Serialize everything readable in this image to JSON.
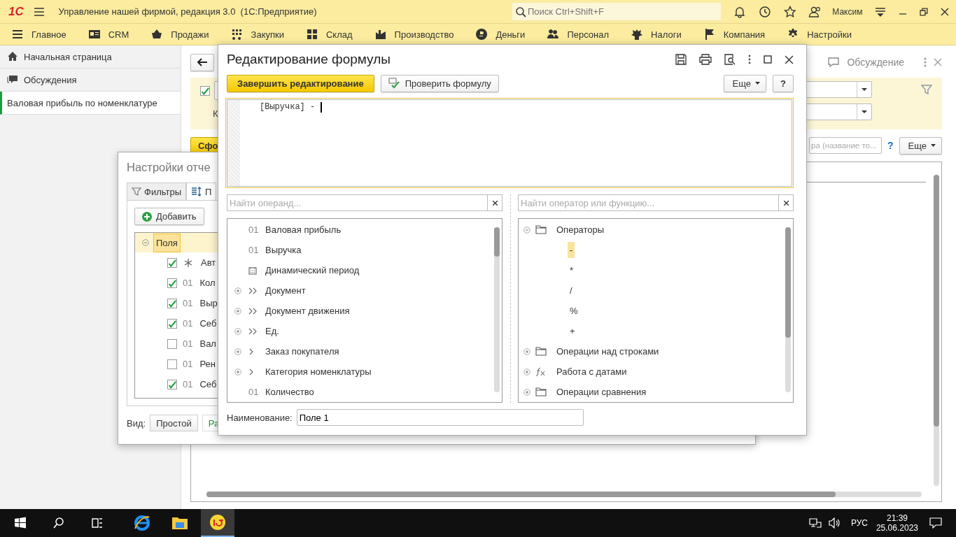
{
  "app_bar": {
    "logo": "1С",
    "title": "Управление нашей фирмой, редакция 3.0  (1С:Предприятие)",
    "search_placeholder": "Поиск Ctrl+Shift+F",
    "user": "Максим"
  },
  "sections": [
    {
      "label": "Главное"
    },
    {
      "label": "CRM"
    },
    {
      "label": "Продажи"
    },
    {
      "label": "Закупки"
    },
    {
      "label": "Склад"
    },
    {
      "label": "Производство"
    },
    {
      "label": "Деньги"
    },
    {
      "label": "Персонал"
    },
    {
      "label": "Налоги"
    },
    {
      "label": "Компания"
    },
    {
      "label": "Настройки"
    }
  ],
  "sidebar": {
    "items": [
      {
        "label": "Начальная страница",
        "selected": false
      },
      {
        "label": "Обсуждения",
        "selected": false
      },
      {
        "label": "Валовая прибыль по номенклатуре",
        "selected": true
      }
    ]
  },
  "report": {
    "discussion_link": "Обсуждение",
    "use_filter": {
      "checked": true
    },
    "label_fragment": "К",
    "generate_button": "Сфо",
    "search_placeholder": "ра (название то...",
    "help": "?",
    "more_button": "Еще"
  },
  "settings_dialog": {
    "title": "Настройки отче",
    "tabs": [
      {
        "label": "Фильтры",
        "selected": false
      },
      {
        "label": "П",
        "selected": true
      }
    ],
    "add_button": "Добавить",
    "tree": {
      "label": "Поля",
      "expanded": true,
      "children": [
        {
          "kind": "auto",
          "checked": true,
          "label": "Авт"
        },
        {
          "kind": "field",
          "checked": true,
          "prefix": "01",
          "label": "Кол"
        },
        {
          "kind": "field",
          "checked": true,
          "prefix": "01",
          "label": "Выр"
        },
        {
          "kind": "field",
          "checked": true,
          "prefix": "01",
          "label": "Себ"
        },
        {
          "kind": "field",
          "checked": false,
          "prefix": "01",
          "label": "Вал"
        },
        {
          "kind": "field",
          "checked": false,
          "prefix": "01",
          "label": "Рен"
        },
        {
          "kind": "field",
          "checked": true,
          "prefix": "01",
          "label": "Себ"
        }
      ]
    },
    "view_label": "Вид:",
    "view_options": [
      {
        "label": "Простой",
        "selected": false
      },
      {
        "label": "Ра",
        "selected": true
      }
    ]
  },
  "formula_dialog": {
    "title": "Редактирование формулы",
    "finish_button": "Завершить редактирование",
    "check_button": "Проверить формулу",
    "more_button": "Еще",
    "help_button": "?",
    "formula": "[Выручка] -",
    "operand_search_placeholder": "Найти операнд...",
    "operator_search_placeholder": "Найти оператор или функцию...",
    "operands": [
      {
        "kind": "number",
        "prefix": "01",
        "label": "Валовая прибыль"
      },
      {
        "kind": "number",
        "prefix": "01",
        "label": "Выручка"
      },
      {
        "kind": "period",
        "label": "Динамический период"
      },
      {
        "kind": "link",
        "label": "Документ",
        "expanded": false
      },
      {
        "kind": "link",
        "label": "Документ движения",
        "expanded": false
      },
      {
        "kind": "link",
        "label": "Ед.",
        "expanded": false
      },
      {
        "kind": "ref",
        "label": "Заказ покупателя",
        "expanded": false
      },
      {
        "kind": "ref",
        "label": "Категория номенклатуры",
        "expanded": false
      },
      {
        "kind": "number",
        "prefix": "01",
        "label": "Количество"
      }
    ],
    "operators": [
      {
        "kind": "folder",
        "label": "Операторы",
        "expanded": true,
        "children": [
          {
            "label": "-",
            "selected": true
          },
          {
            "label": "*",
            "selected": false
          },
          {
            "label": "/",
            "selected": false
          },
          {
            "label": "%",
            "selected": false
          },
          {
            "label": "+",
            "selected": false
          }
        ]
      },
      {
        "kind": "folder",
        "label": "Операции над строками",
        "expanded": false
      },
      {
        "kind": "function",
        "label": "Работа с датами",
        "expanded": false
      },
      {
        "kind": "folder",
        "label": "Операции сравнения",
        "expanded": false
      }
    ],
    "name_label": "Наименование:",
    "name_value": "Поле 1"
  },
  "taskbar": {
    "pinned": [
      {
        "selected": false
      },
      {
        "selected": false
      },
      {
        "selected": true
      }
    ],
    "language": "РУС",
    "time": "21:39",
    "date": "25.06.2023"
  }
}
